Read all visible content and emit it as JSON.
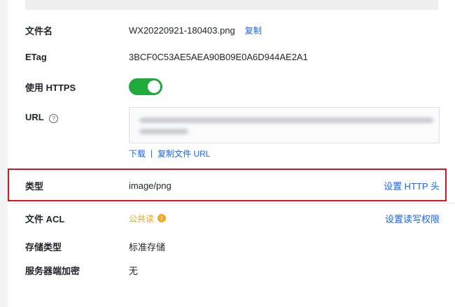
{
  "fields": {
    "filename": {
      "label": "文件名",
      "value": "WX20220921-180403.png",
      "copy_label": "复制"
    },
    "etag": {
      "label": "ETag",
      "value": "3BCF0C53AE5AEA90B09E0A6D944AE2A1"
    },
    "https": {
      "label": "使用 HTTPS",
      "enabled": true
    },
    "url": {
      "label": "URL",
      "help_icon": "question-circle-icon",
      "download_label": "下载",
      "separator": "|",
      "copy_url_label": "复制文件 URL"
    },
    "type": {
      "label": "类型",
      "value": "image/png",
      "action_label": "设置 HTTP 头"
    },
    "acl": {
      "label": "文件 ACL",
      "value": "公共读",
      "warn_icon": "!",
      "action_label": "设置读写权限"
    },
    "storage_class": {
      "label": "存储类型",
      "value": "标准存储"
    },
    "encryption": {
      "label": "服务器端加密",
      "value": "无"
    }
  },
  "colors": {
    "link": "#1664ff",
    "toggle_on": "#1faa3b",
    "highlight_border": "#e0121d",
    "acl_warning": "#e8a317"
  }
}
